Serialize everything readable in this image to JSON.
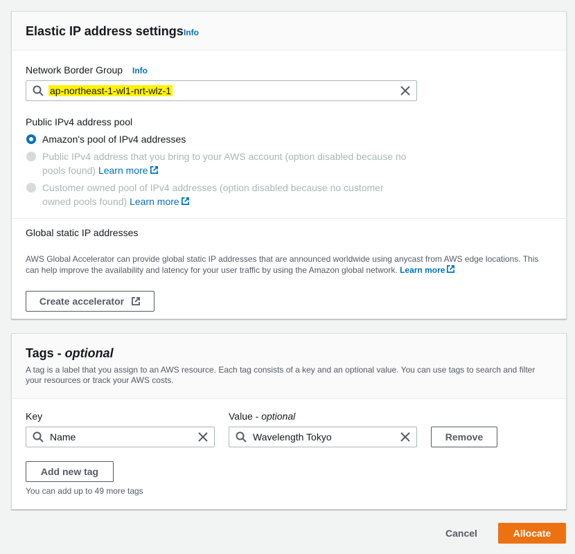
{
  "elastic_ip": {
    "title": "Elastic IP address settings",
    "info": "Info",
    "network_border_group": {
      "label": "Network Border Group",
      "info": "Info",
      "value": "ap-northeast-1-wl1-nrt-wlz-1"
    },
    "pool": {
      "label": "Public IPv4 address pool",
      "options": [
        {
          "line1": "Amazon's pool of IPv4 addresses",
          "line2": "",
          "link": "",
          "selected": true,
          "disabled": false
        },
        {
          "line1": "Public IPv4 address that you bring to your AWS account (option disabled because no",
          "line2": "pools found)",
          "link": "Learn more",
          "selected": false,
          "disabled": true
        },
        {
          "line1": "Customer owned pool of IPv4 addresses (option disabled because no customer",
          "line2": "owned pools found)",
          "link": "Learn more",
          "selected": false,
          "disabled": true
        }
      ]
    },
    "global_static": {
      "label": "Global static IP addresses",
      "description_line1": "AWS Global Accelerator can provide global static IP addresses that are announced worldwide using anycast from AWS edge locations. This",
      "description_line2": "can help improve the availability and latency for your user traffic by using the Amazon global network.",
      "learn_more": "Learn more",
      "button": "Create accelerator"
    }
  },
  "tags": {
    "title": "Tags - ",
    "title_optional": "optional",
    "description_line1": "A tag is a label that you assign to an AWS resource. Each tag consists of a key and an optional value. You can use tags to search and filter",
    "description_line2": "your resources or track your AWS costs.",
    "key_label": "Key",
    "value_label": "Value - ",
    "value_optional": "optional",
    "key_value": "Name",
    "value_value": "Wavelength Tokyo",
    "remove": "Remove",
    "add_new_tag": "Add new tag",
    "limit_note": "You can add up to 49 more tags"
  },
  "footer": {
    "cancel": "Cancel",
    "allocate": "Allocate"
  },
  "colors": {
    "accent": "#0073bb",
    "primary_button": "#ec7211",
    "highlight": "#fff200"
  },
  "icons": [
    "search-icon",
    "clear-icon",
    "external-link-icon",
    "radio-icon"
  ]
}
